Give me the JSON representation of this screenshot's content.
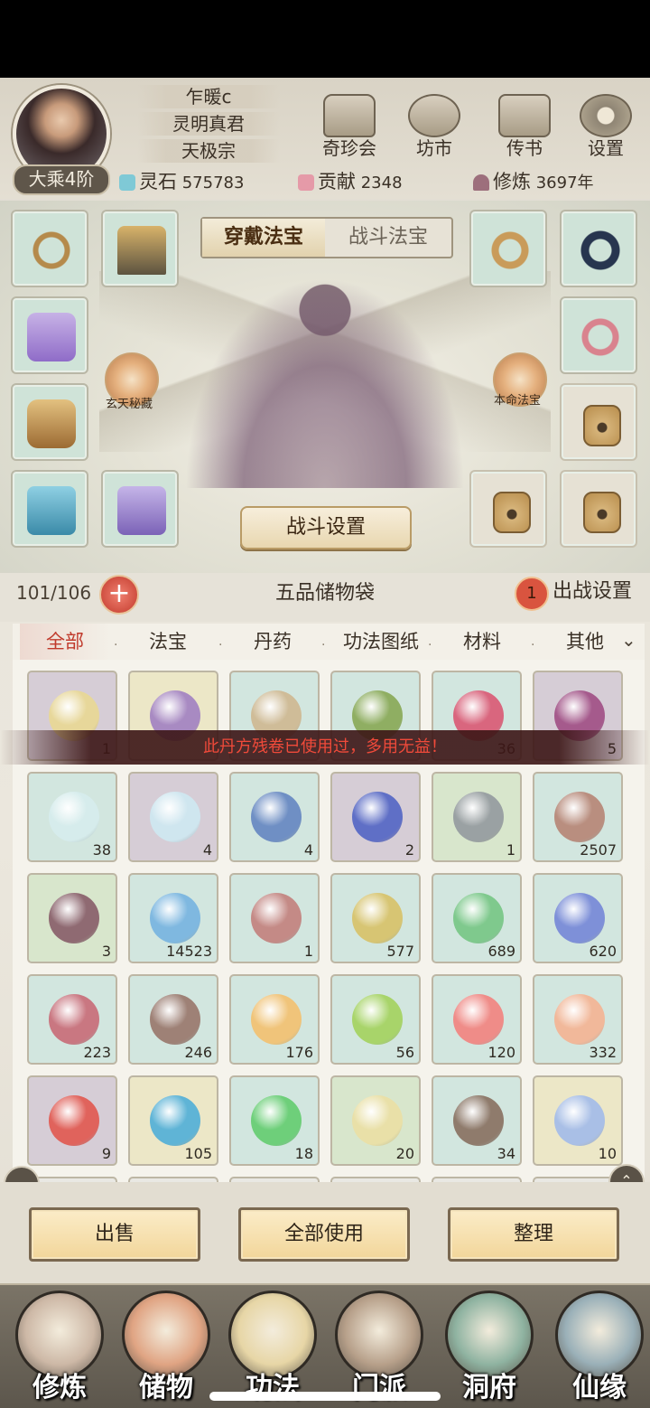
{
  "player": {
    "name": "乍暖c",
    "title": "灵明真君",
    "sect": "天极宗",
    "realm": "大乘4阶"
  },
  "top_menu": [
    {
      "label": "奇珍会",
      "icon": "treasure-pavilion-icon"
    },
    {
      "label": "坊市",
      "icon": "market-icon"
    },
    {
      "label": "传书",
      "icon": "letter-icon"
    },
    {
      "label": "设置",
      "icon": "gear-icon"
    }
  ],
  "stats": {
    "spirit_stone": {
      "label": "灵石",
      "value": "575783"
    },
    "contribution": {
      "label": "贡献",
      "value": "2348"
    },
    "cultivation": {
      "label": "修炼",
      "value": "3697年"
    }
  },
  "equip_tabs": {
    "active": "穿戴法宝",
    "inactive": "战斗法宝"
  },
  "side_features": {
    "left": "玄天秘藏",
    "right": "本命法宝"
  },
  "battle_settings_label": "战斗设置",
  "bag": {
    "capacity": "101/106",
    "title": "五品储物袋",
    "deploy_count": "1",
    "deploy_label": "出战设置"
  },
  "filters": [
    "全部",
    "法宝",
    "丹药",
    "功法图纸",
    "材料",
    "其他"
  ],
  "toast": "此丹方残卷已使用过，多用无益！",
  "items": [
    {
      "bg": "purple",
      "color": "#e7d79a",
      "count": "1"
    },
    {
      "bg": "yellow",
      "color": "#a88ac2",
      "count": ""
    },
    {
      "bg": "cyan",
      "color": "#cfbc98",
      "count": ""
    },
    {
      "bg": "cyan",
      "color": "#8fae62",
      "count": ""
    },
    {
      "bg": "cyan",
      "color": "#d9667e",
      "count": "36"
    },
    {
      "bg": "purple",
      "color": "#a55a8c",
      "count": "5"
    },
    {
      "bg": "cyan",
      "color": "#d6ecec",
      "count": "38"
    },
    {
      "bg": "purple",
      "color": "#cfe6ef",
      "count": "4"
    },
    {
      "bg": "cyan",
      "color": "#6f8fc4",
      "count": "4"
    },
    {
      "bg": "purple",
      "color": "#5f6fc6",
      "count": "2"
    },
    {
      "bg": "green",
      "color": "#9aa1a3",
      "count": "1"
    },
    {
      "bg": "cyan",
      "color": "#b98e7f",
      "count": "2507"
    },
    {
      "bg": "green",
      "color": "#8f6a72",
      "count": "3"
    },
    {
      "bg": "cyan",
      "color": "#7fb8e0",
      "count": "14523"
    },
    {
      "bg": "cyan",
      "color": "#c48a86",
      "count": "1"
    },
    {
      "bg": "cyan",
      "color": "#d7c573",
      "count": "577"
    },
    {
      "bg": "cyan",
      "color": "#7fc98d",
      "count": "689"
    },
    {
      "bg": "cyan",
      "color": "#7e90d8",
      "count": "620"
    },
    {
      "bg": "cyan",
      "color": "#c97781",
      "count": "223"
    },
    {
      "bg": "cyan",
      "color": "#9e8176",
      "count": "246"
    },
    {
      "bg": "cyan",
      "color": "#f0c47a",
      "count": "176"
    },
    {
      "bg": "cyan",
      "color": "#a8d46a",
      "count": "56"
    },
    {
      "bg": "cyan",
      "color": "#ef8c88",
      "count": "120"
    },
    {
      "bg": "cyan",
      "color": "#f1b89a",
      "count": "332"
    },
    {
      "bg": "purple",
      "color": "#e0635c",
      "count": "9"
    },
    {
      "bg": "yellow",
      "color": "#5fb4d6",
      "count": "105"
    },
    {
      "bg": "cyan",
      "color": "#6ecf7a",
      "count": "18"
    },
    {
      "bg": "green",
      "color": "#e9e0a8",
      "count": "20"
    },
    {
      "bg": "cyan",
      "color": "#8f7b6c",
      "count": "34"
    },
    {
      "bg": "yellow",
      "color": "#a9bfe6",
      "count": "10"
    }
  ],
  "actions": [
    "出售",
    "全部使用",
    "整理"
  ],
  "nav": [
    {
      "label": "修炼",
      "icon": "cultivate-icon",
      "color": "#cdb8a6"
    },
    {
      "label": "储物",
      "icon": "storage-bag-icon",
      "color": "#e0a483"
    },
    {
      "label": "功法",
      "icon": "scroll-icon",
      "color": "#e7d6a6"
    },
    {
      "label": "门派",
      "icon": "sect-hall-icon",
      "color": "#b7a08a"
    },
    {
      "label": "洞府",
      "icon": "cave-dwelling-icon",
      "color": "#8fb3a1"
    },
    {
      "label": "仙缘",
      "icon": "fate-swirl-icon",
      "color": "#9ab0b8"
    }
  ]
}
